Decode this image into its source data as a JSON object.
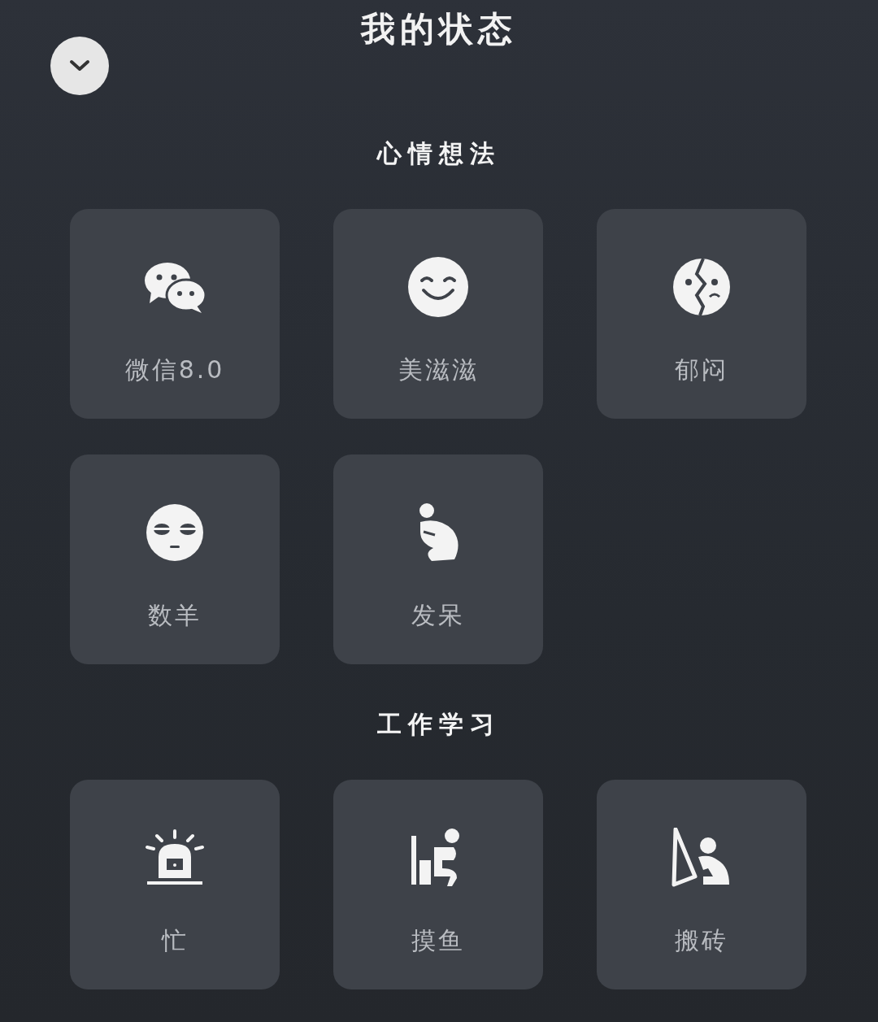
{
  "title": "我的状态",
  "sections": [
    {
      "title": "心情想法",
      "items": [
        {
          "label": "微信8.0"
        },
        {
          "label": "美滋滋"
        },
        {
          "label": "郁闷"
        },
        {
          "label": "数羊"
        },
        {
          "label": "发呆"
        }
      ]
    },
    {
      "title": "工作学习",
      "items": [
        {
          "label": "忙"
        },
        {
          "label": "摸鱼"
        },
        {
          "label": "搬砖"
        }
      ]
    }
  ]
}
